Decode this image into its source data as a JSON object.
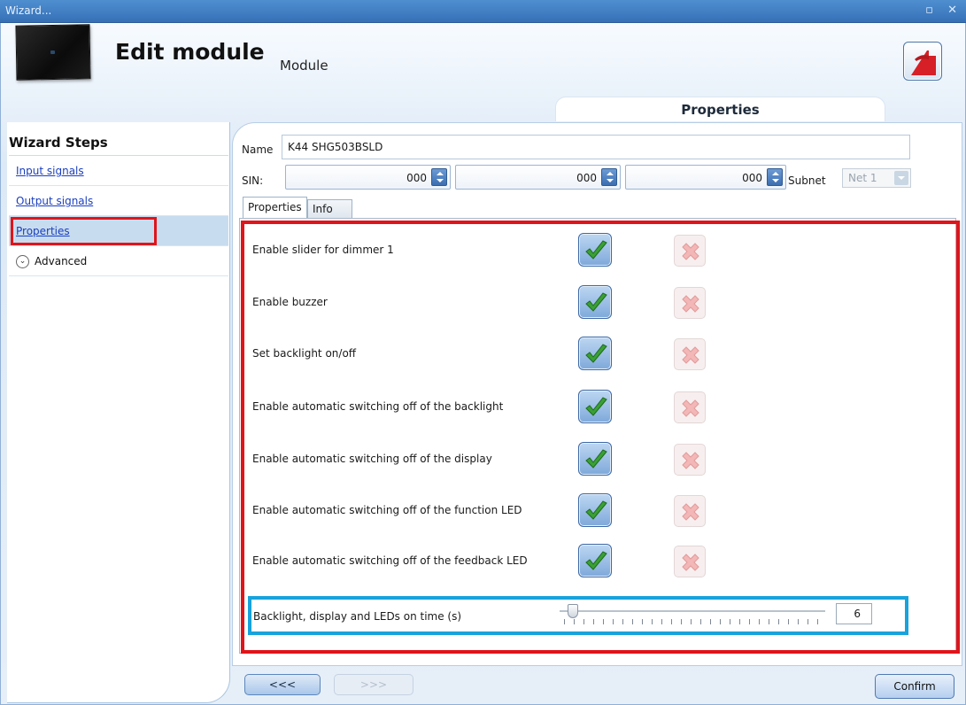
{
  "window": {
    "title": "Wizard...",
    "controls": "▫ ✕"
  },
  "header": {
    "title": "Edit module",
    "subtitle": "Module"
  },
  "properties_tab_label": "Properties",
  "steps": {
    "title": "Wizard Steps",
    "items": [
      {
        "label": "Input signals"
      },
      {
        "label": "Output signals"
      },
      {
        "label": "Properties"
      },
      {
        "label": "Advanced"
      }
    ]
  },
  "form": {
    "name_label": "Name",
    "name_value": "K44 SHG503BSLD",
    "sin_label": "SIN:",
    "sin_values": [
      "000",
      "000",
      "000"
    ],
    "subnet_label": "Subnet",
    "subnet_value": "Net 1"
  },
  "inner_tabs": [
    "Properties",
    "Info"
  ],
  "properties": [
    {
      "label": "Enable slider for dimmer 1",
      "enabled": true
    },
    {
      "label": "Enable buzzer",
      "enabled": true
    },
    {
      "label": "Set backlight on/off",
      "enabled": true
    },
    {
      "label": "Enable automatic switching off of the backlight",
      "enabled": true
    },
    {
      "label": "Enable automatic switching off of the display",
      "enabled": true
    },
    {
      "label": "Enable automatic switching off of the function LED",
      "enabled": true
    },
    {
      "label": "Enable automatic switching off of the feedback LED",
      "enabled": true
    }
  ],
  "slider": {
    "label": "Backlight, display and LEDs on time (s)",
    "value": "6"
  },
  "buttons": {
    "back": "<<<",
    "next": ">>>",
    "confirm": "Confirm"
  },
  "colors": {
    "highlight_red": "#e0141b",
    "highlight_blue": "#17a3dc",
    "accent": "#3670b6"
  }
}
